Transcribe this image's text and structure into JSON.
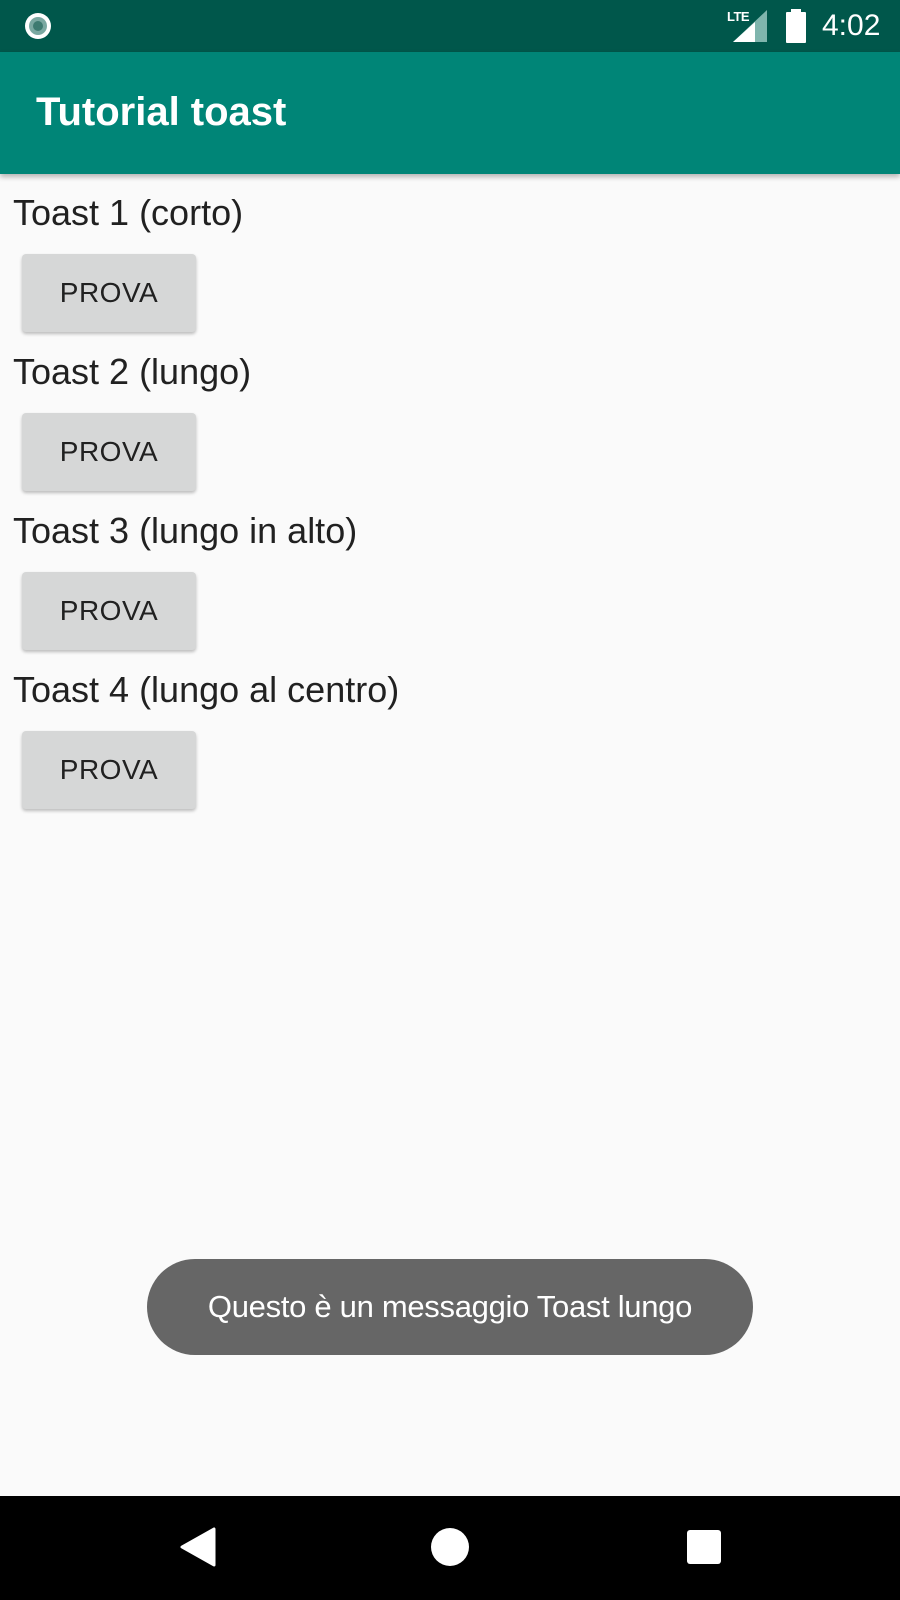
{
  "status_bar": {
    "left_icon": "circle-notification-icon",
    "network_label": "LTE",
    "signal_icon": "signal-icon",
    "battery_icon": "battery-icon",
    "time": "4:02"
  },
  "app_bar": {
    "title": "Tutorial toast"
  },
  "toasts": [
    {
      "label": "Toast 1 (corto)",
      "button_label": "PROVA"
    },
    {
      "label": "Toast 2 (lungo)",
      "button_label": "PROVA"
    },
    {
      "label": "Toast 3 (lungo in alto)",
      "button_label": "PROVA"
    },
    {
      "label": "Toast 4 (lungo al centro)",
      "button_label": "PROVA"
    }
  ],
  "toast_message": "Questo è un messaggio Toast lungo",
  "nav_bar": {
    "back_icon": "back-icon",
    "home_icon": "home-icon",
    "recent_icon": "recent-apps-icon"
  },
  "colors": {
    "status_bar": "#00574b",
    "app_bar": "#008577",
    "background": "#fafafa",
    "button": "#d6d7d7",
    "toast": "#666666"
  }
}
